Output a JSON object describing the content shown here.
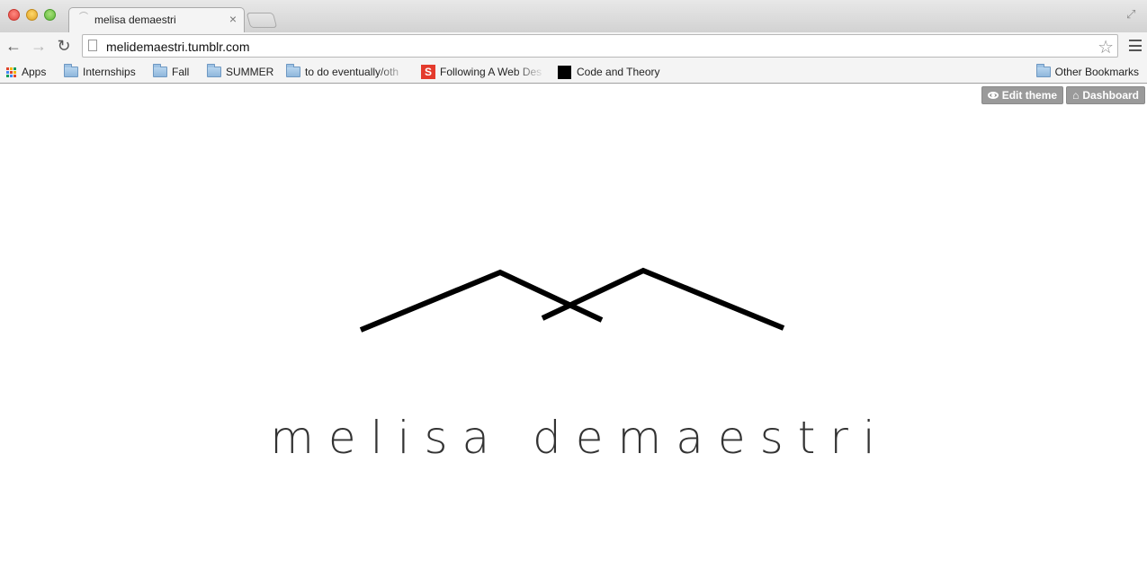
{
  "browser": {
    "tab": {
      "title": "melisa demaestri",
      "close": "×"
    },
    "address": {
      "url": "melidemaestri.tumblr.com"
    },
    "bookmarks": [
      {
        "label": "Apps",
        "icon": "apps-icon"
      },
      {
        "label": "Internships",
        "icon": "folder-icon"
      },
      {
        "label": "Fall",
        "icon": "folder-icon"
      },
      {
        "label": "SUMMER",
        "icon": "folder-icon"
      },
      {
        "label": "to do eventually/oth",
        "icon": "folder-icon"
      },
      {
        "label": "Following A Web Des",
        "icon": "s-icon"
      },
      {
        "label": "Code and Theory",
        "icon": "black-square-icon"
      }
    ],
    "other_bookmarks": "Other Bookmarks"
  },
  "page": {
    "controls": {
      "edit_theme": "Edit theme",
      "dashboard": "Dashboard"
    },
    "site_name": "melisa demaestri",
    "logo_color": "#000000"
  }
}
